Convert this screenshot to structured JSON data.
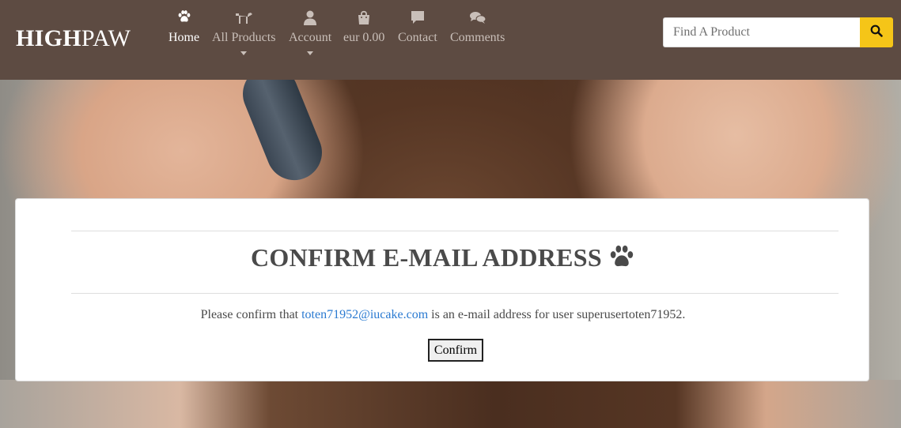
{
  "header": {
    "logo_bold": "HIGH",
    "logo_light": "PAW",
    "nav": [
      {
        "label": "Home",
        "icon": "paw-icon",
        "active": true
      },
      {
        "label": "All Products",
        "icon": "dog-icon",
        "dropdown": true
      },
      {
        "label": "Account",
        "icon": "user-icon",
        "dropdown": true
      },
      {
        "label": "eur 0.00",
        "icon": "shopping-bag-icon"
      },
      {
        "label": "Contact",
        "icon": "comment-icon"
      },
      {
        "label": "Comments",
        "icon": "comments-icon"
      }
    ],
    "search": {
      "placeholder": "Find A Product",
      "value": "",
      "button_icon": "search-icon"
    }
  },
  "card": {
    "title": "CONFIRM E-MAIL ADDRESS",
    "title_icon": "paw-icon",
    "message_prefix": "Please confirm that",
    "email": "toten71952@iucake.com",
    "message_suffix": "is an e-mail address for user superusertoten71952.",
    "confirm_label": "Confirm"
  },
  "colors": {
    "header_bg": "#5d4b42",
    "search_button": "#f5c518",
    "link": "#2a7ad1"
  }
}
